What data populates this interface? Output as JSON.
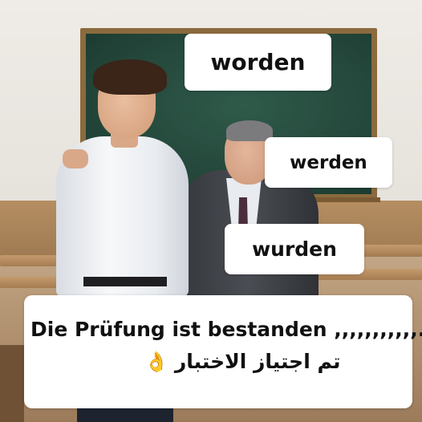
{
  "choices": [
    {
      "label": "worden"
    },
    {
      "label": "werden"
    },
    {
      "label": "wurden"
    }
  ],
  "prompt": {
    "german": "Die Prüfung ist bestanden ,,,,,,,,,,,.",
    "arabic": "تم اجتياز الاختبار",
    "icon": "ok-hand-icon"
  },
  "colors": {
    "card_background": "#ffffff",
    "text": "#111111",
    "chalkboard": "#224438"
  }
}
